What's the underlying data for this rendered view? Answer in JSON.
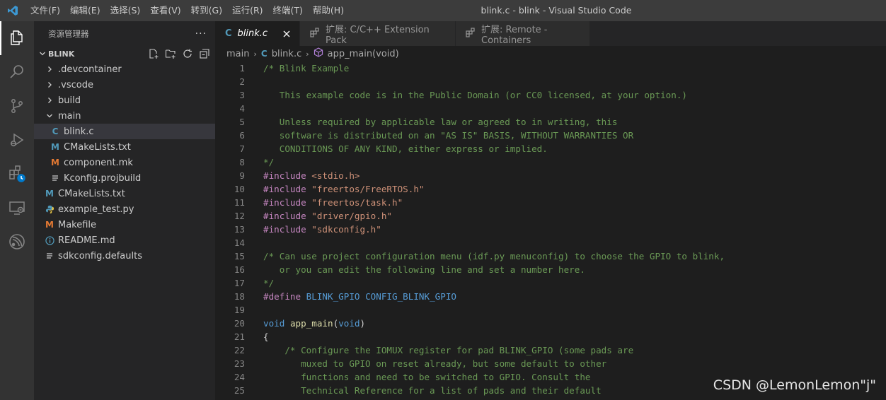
{
  "titlebar": {
    "menu": [
      "文件(F)",
      "编辑(E)",
      "选择(S)",
      "查看(V)",
      "转到(G)",
      "运行(R)",
      "终端(T)",
      "帮助(H)"
    ],
    "window_title": "blink.c - blink - Visual Studio Code"
  },
  "activitybar": {
    "icons": [
      "explorer-icon",
      "search-icon",
      "source-control-icon",
      "run-debug-icon",
      "extensions-icon",
      "remote-explorer-icon",
      "esp-idf-icon"
    ]
  },
  "sidebar": {
    "title": "资源管理器",
    "more": "···",
    "project": "BLINK",
    "items": [
      {
        "label": ".devcontainer",
        "kind": "folder",
        "expanded": false,
        "depth": 1
      },
      {
        "label": ".vscode",
        "kind": "folder",
        "expanded": false,
        "depth": 1
      },
      {
        "label": "build",
        "kind": "folder",
        "expanded": false,
        "depth": 1
      },
      {
        "label": "main",
        "kind": "folder",
        "expanded": true,
        "depth": 1
      },
      {
        "label": "blink.c",
        "kind": "c",
        "depth": 2,
        "selected": true
      },
      {
        "label": "CMakeLists.txt",
        "kind": "cmake",
        "depth": 2
      },
      {
        "label": "component.mk",
        "kind": "make",
        "depth": 2
      },
      {
        "label": "Kconfig.projbuild",
        "kind": "text",
        "depth": 2
      },
      {
        "label": "CMakeLists.txt",
        "kind": "cmake",
        "depth": 1
      },
      {
        "label": "example_test.py",
        "kind": "python",
        "depth": 1
      },
      {
        "label": "Makefile",
        "kind": "make",
        "depth": 1
      },
      {
        "label": "README.md",
        "kind": "info",
        "depth": 1
      },
      {
        "label": "sdkconfig.defaults",
        "kind": "text",
        "depth": 1
      }
    ]
  },
  "tabs": [
    {
      "label": "blink.c",
      "active": true,
      "icon": "C"
    },
    {
      "label": "扩展: C/C++ Extension Pack",
      "active": false
    },
    {
      "label": "扩展: Remote - Containers",
      "active": false
    }
  ],
  "breadcrumb": [
    "main",
    "blink.c",
    "app_main(void)"
  ],
  "code": [
    [
      [
        "comment",
        "/* Blink Example"
      ]
    ],
    [
      [
        "plain",
        ""
      ]
    ],
    [
      [
        "comment",
        "   This example code is in the Public Domain (or CC0 licensed, at your option.)"
      ]
    ],
    [
      [
        "plain",
        ""
      ]
    ],
    [
      [
        "comment",
        "   Unless required by applicable law or agreed to in writing, this"
      ]
    ],
    [
      [
        "comment",
        "   software is distributed on an \"AS IS\" BASIS, WITHOUT WARRANTIES OR"
      ]
    ],
    [
      [
        "comment",
        "   CONDITIONS OF ANY KIND, either express or implied."
      ]
    ],
    [
      [
        "comment",
        "*/"
      ]
    ],
    [
      [
        "keyword",
        "#include"
      ],
      [
        "plain",
        " "
      ],
      [
        "string",
        "<stdio.h>"
      ]
    ],
    [
      [
        "keyword",
        "#include"
      ],
      [
        "plain",
        " "
      ],
      [
        "string",
        "\"freertos/FreeRTOS.h\""
      ]
    ],
    [
      [
        "keyword",
        "#include"
      ],
      [
        "plain",
        " "
      ],
      [
        "string",
        "\"freertos/task.h\""
      ]
    ],
    [
      [
        "keyword",
        "#include"
      ],
      [
        "plain",
        " "
      ],
      [
        "string",
        "\"driver/gpio.h\""
      ]
    ],
    [
      [
        "keyword",
        "#include"
      ],
      [
        "plain",
        " "
      ],
      [
        "string",
        "\"sdkconfig.h\""
      ]
    ],
    [
      [
        "plain",
        ""
      ]
    ],
    [
      [
        "comment",
        "/* Can use project configuration menu (idf.py menuconfig) to choose the GPIO to blink,"
      ]
    ],
    [
      [
        "comment",
        "   or you can edit the following line and set a number here."
      ]
    ],
    [
      [
        "comment",
        "*/"
      ]
    ],
    [
      [
        "keyword",
        "#define"
      ],
      [
        "plain",
        " "
      ],
      [
        "ident",
        "BLINK_GPIO"
      ],
      [
        "plain",
        " "
      ],
      [
        "ident",
        "CONFIG_BLINK_GPIO"
      ]
    ],
    [
      [
        "plain",
        ""
      ]
    ],
    [
      [
        "type",
        "void"
      ],
      [
        "plain",
        " "
      ],
      [
        "func",
        "app_main"
      ],
      [
        "plain",
        "("
      ],
      [
        "type",
        "void"
      ],
      [
        "plain",
        ")"
      ]
    ],
    [
      [
        "plain",
        "{"
      ]
    ],
    [
      [
        "plain",
        "    "
      ],
      [
        "comment",
        "/* Configure the IOMUX register for pad BLINK_GPIO (some pads are"
      ]
    ],
    [
      [
        "comment",
        "       muxed to GPIO on reset already, but some default to other"
      ]
    ],
    [
      [
        "comment",
        "       functions and need to be switched to GPIO. Consult the"
      ]
    ],
    [
      [
        "comment",
        "       Technical Reference for a list of pads and their default"
      ]
    ]
  ],
  "watermark": "CSDN @LemonLemon\"j\""
}
